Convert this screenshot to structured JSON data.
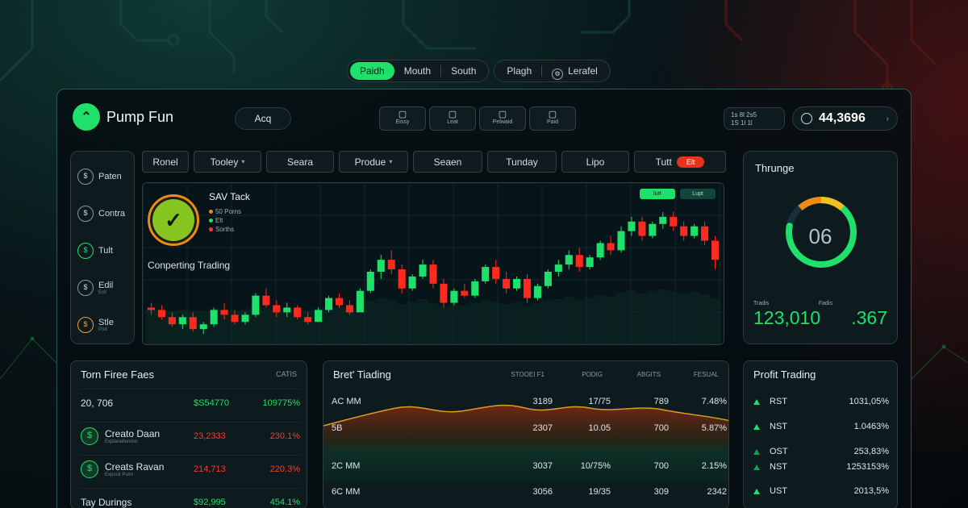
{
  "colors": {
    "accent_green": "#1fe06a",
    "accent_red": "#ff3b2f",
    "warn_orange": "#f08a16",
    "panel": "#0d1a1e"
  },
  "topnav": {
    "group1": [
      "Paidh",
      "Mouth",
      "South"
    ],
    "group2": [
      "Plagh",
      "Lerafel"
    ],
    "active": "Paidh"
  },
  "header": {
    "app_name": "Pump Fun",
    "acq_label": "Acq",
    "tools": [
      {
        "icon": "document-icon",
        "label": "Eissy"
      },
      {
        "icon": "chart-icon",
        "label": "Leat"
      },
      {
        "icon": "home-icon",
        "label": "Pelwaid"
      },
      {
        "icon": "calculator-icon",
        "label": "Paid"
      }
    ],
    "mini_info": [
      "1s 8l 2s5",
      "1S 1l 1l"
    ],
    "balance": "44,3696"
  },
  "sidebar": {
    "items": [
      {
        "label": "Paten",
        "sub": "",
        "icon": "dollar-icon",
        "glyph": "$",
        "style": ""
      },
      {
        "label": "Contra",
        "sub": "",
        "icon": "dollar-icon",
        "glyph": "$",
        "style": ""
      },
      {
        "label": "Tult",
        "sub": "",
        "icon": "coin-icon",
        "glyph": "$",
        "style": "green"
      },
      {
        "label": "Edil",
        "sub": "Ecil",
        "icon": "dollar-icon",
        "glyph": "$",
        "style": ""
      },
      {
        "label": "Stle",
        "sub": "Pod",
        "icon": "coin-icon",
        "glyph": "$",
        "style": "orange"
      }
    ]
  },
  "tabs": [
    {
      "label": "Ronel",
      "dropdown": false,
      "w": 58
    },
    {
      "label": "Tooley",
      "dropdown": true,
      "w": 84
    },
    {
      "label": "Seara",
      "dropdown": false,
      "w": 84
    },
    {
      "label": "Produe",
      "dropdown": true,
      "w": 86
    },
    {
      "label": "Seaen",
      "dropdown": false,
      "w": 86
    },
    {
      "label": "Tunday",
      "dropdown": false,
      "w": 86
    },
    {
      "label": "Lipo",
      "dropdown": false,
      "w": 84
    },
    {
      "label": "Tutt",
      "dropdown": false,
      "w": 114,
      "badge": "Elt"
    }
  ],
  "chart": {
    "title": "SAV Tack",
    "legend": [
      "50 Porns",
      "Elt",
      "Sorths"
    ],
    "left_label": "Conperting Trading",
    "toggles": [
      "lurt",
      "Lupt"
    ]
  },
  "chart_data": {
    "type": "candlestick",
    "title": "SAV Tack",
    "series": [
      {
        "name": "price",
        "values": [
          [
            50,
            52,
            47,
            49
          ],
          [
            49,
            51,
            45,
            46
          ],
          [
            46,
            48,
            42,
            43
          ],
          [
            43,
            47,
            41,
            46
          ],
          [
            46,
            48,
            40,
            41
          ],
          [
            41,
            44,
            39,
            43
          ],
          [
            43,
            50,
            42,
            49
          ],
          [
            49,
            52,
            45,
            47
          ],
          [
            47,
            49,
            43,
            44
          ],
          [
            44,
            48,
            43,
            47
          ],
          [
            47,
            56,
            46,
            55
          ],
          [
            55,
            58,
            50,
            51
          ],
          [
            51,
            53,
            46,
            48
          ],
          [
            48,
            52,
            46,
            50
          ],
          [
            50,
            51,
            45,
            46
          ],
          [
            46,
            48,
            43,
            44
          ],
          [
            44,
            50,
            44,
            49
          ],
          [
            49,
            55,
            48,
            54
          ],
          [
            54,
            56,
            50,
            51
          ],
          [
            51,
            53,
            47,
            48
          ],
          [
            48,
            58,
            48,
            57
          ],
          [
            57,
            66,
            56,
            65
          ],
          [
            65,
            72,
            62,
            70
          ],
          [
            70,
            74,
            64,
            66
          ],
          [
            66,
            68,
            56,
            58
          ],
          [
            58,
            64,
            57,
            63
          ],
          [
            63,
            70,
            62,
            68
          ],
          [
            68,
            70,
            58,
            60
          ],
          [
            60,
            62,
            50,
            52
          ],
          [
            52,
            58,
            51,
            57
          ],
          [
            57,
            60,
            54,
            55
          ],
          [
            55,
            62,
            54,
            61
          ],
          [
            61,
            68,
            60,
            67
          ],
          [
            67,
            70,
            60,
            62
          ],
          [
            62,
            65,
            56,
            58
          ],
          [
            58,
            63,
            57,
            62
          ],
          [
            62,
            64,
            52,
            54
          ],
          [
            54,
            60,
            53,
            59
          ],
          [
            59,
            66,
            58,
            65
          ],
          [
            65,
            70,
            63,
            68
          ],
          [
            68,
            74,
            66,
            72
          ],
          [
            72,
            75,
            65,
            67
          ],
          [
            67,
            72,
            66,
            71
          ],
          [
            71,
            78,
            70,
            77
          ],
          [
            77,
            80,
            72,
            74
          ],
          [
            74,
            84,
            73,
            82
          ],
          [
            82,
            88,
            80,
            86
          ],
          [
            86,
            88,
            78,
            80
          ],
          [
            80,
            86,
            79,
            85
          ],
          [
            85,
            90,
            83,
            88
          ],
          [
            88,
            90,
            82,
            84
          ],
          [
            84,
            86,
            78,
            80
          ],
          [
            80,
            85,
            79,
            84
          ],
          [
            84,
            86,
            76,
            78
          ],
          [
            78,
            80,
            66,
            70
          ]
        ]
      }
    ],
    "ylim": [
      38,
      92
    ]
  },
  "gauge": {
    "title": "Thrunge",
    "value": "06",
    "fraction": 0.78,
    "left_caption": "Tradis",
    "right_caption": "Fadis",
    "left_value": "123,010",
    "right_value": ".367"
  },
  "panel_fees": {
    "title": "Torn Firee Faes",
    "header": "CATIS",
    "rows": [
      {
        "name": "20, 706",
        "sub": "",
        "c1": "$S54770",
        "c2": "109775%",
        "color": "green",
        "icon": false
      },
      {
        "name": "Creato Daan",
        "sub": "Explanationdoc",
        "c1": "23,2333",
        "c2": "230.1%",
        "color": "red",
        "icon": true
      },
      {
        "name": "Creats Ravan",
        "sub": "Exposit Pstrn",
        "c1": "214,713",
        "c2": "220.3%",
        "color": "red",
        "icon": true
      },
      {
        "name": "Tay Durings",
        "sub": "",
        "c1": "$92,995",
        "c2": "454.1%",
        "color": "green",
        "icon": false
      }
    ]
  },
  "panel_best": {
    "title": "Bret' Tiading",
    "cols": [
      "STOOEI F1",
      "PODIG",
      "ABGITS",
      "FESUAL"
    ],
    "rows": [
      {
        "name": "AC MM",
        "v": [
          "3189",
          "17/75",
          "789",
          "7.48%"
        ]
      },
      {
        "name": "5B",
        "v": [
          "2307",
          "10.05",
          "700",
          "5.87%"
        ]
      },
      {
        "name": "2C MM",
        "v": [
          "3037",
          "10/75%",
          "700",
          "2.15%"
        ]
      },
      {
        "name": "6C MM",
        "v": [
          "3056",
          "19/35",
          "309",
          "2342"
        ]
      }
    ]
  },
  "panel_profit": {
    "title": "Profit Trading",
    "rows": [
      {
        "name": "RST",
        "v": "1031,05%"
      },
      {
        "name": "NST",
        "v": "1.0463%"
      },
      {
        "name": "OST",
        "v": "253,83%"
      },
      {
        "name": "NST",
        "v": "1253153%"
      },
      {
        "name": "UST",
        "v": "2013,5%"
      }
    ]
  }
}
